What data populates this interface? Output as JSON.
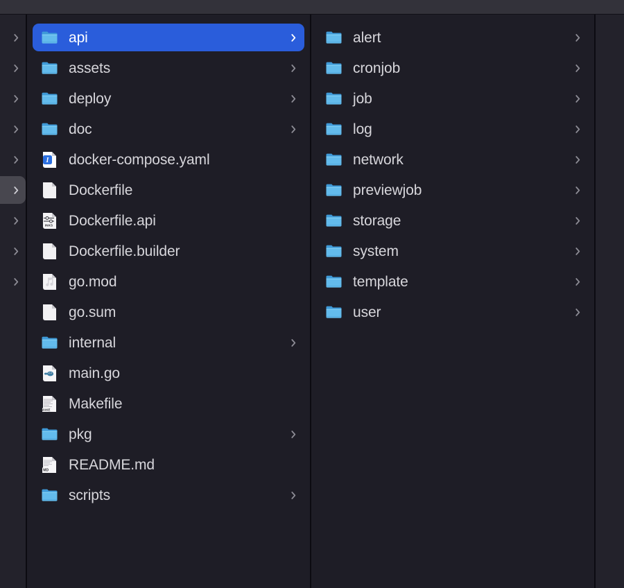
{
  "window": {
    "view_mode": "column-view",
    "titlebar_color": "#33322a"
  },
  "colors": {
    "background": "#1e1d26",
    "selection_active": "#2a5ddb",
    "selection_inactive": "#48474f",
    "divider": "#0c0b11",
    "text": "#d7d6db",
    "text_selected": "#ffffff",
    "chevron": "#8d8c95",
    "folder_blue": "#5bb3e8",
    "folder_tab": "#3f9ad8"
  },
  "columns": [
    {
      "name": "ancestor-column-partial",
      "partial": true,
      "items": [
        {
          "label": "",
          "icon": "folder-icon",
          "kind": "folder",
          "chevron": true,
          "selected": false
        },
        {
          "label": "",
          "icon": "folder-icon",
          "kind": "folder",
          "chevron": true,
          "selected": false
        },
        {
          "label": "",
          "icon": "folder-icon",
          "kind": "folder",
          "chevron": true,
          "selected": false
        },
        {
          "label": "",
          "icon": "folder-icon",
          "kind": "folder",
          "chevron": true,
          "selected": false
        },
        {
          "label": "",
          "icon": "folder-icon",
          "kind": "folder",
          "chevron": true,
          "selected": false
        },
        {
          "label": "",
          "icon": "folder-icon",
          "kind": "folder",
          "chevron": true,
          "selected": "inactive"
        },
        {
          "label": "",
          "icon": "folder-icon",
          "kind": "folder",
          "chevron": true,
          "selected": false
        },
        {
          "label": "",
          "icon": "folder-icon",
          "kind": "folder",
          "chevron": true,
          "selected": false
        },
        {
          "label": "",
          "icon": "folder-icon",
          "kind": "folder",
          "chevron": true,
          "selected": false
        }
      ]
    },
    {
      "name": "project-root-column",
      "partial": false,
      "items": [
        {
          "label": "api",
          "icon": "folder-icon",
          "kind": "folder",
          "chevron": true,
          "selected": true
        },
        {
          "label": "assets",
          "icon": "folder-icon",
          "kind": "folder",
          "chevron": true,
          "selected": false
        },
        {
          "label": "deploy",
          "icon": "folder-icon",
          "kind": "folder",
          "chevron": true,
          "selected": false
        },
        {
          "label": "doc",
          "icon": "folder-icon",
          "kind": "folder",
          "chevron": true,
          "selected": false
        },
        {
          "label": "docker-compose.yaml",
          "icon": "yaml-file-icon",
          "kind": "file",
          "chevron": false,
          "selected": false
        },
        {
          "label": "Dockerfile",
          "icon": "blank-document-icon",
          "kind": "file",
          "chevron": false,
          "selected": false
        },
        {
          "label": "Dockerfile.api",
          "icon": "settings-file-icon",
          "kind": "file",
          "chevron": false,
          "selected": false
        },
        {
          "label": "Dockerfile.builder",
          "icon": "blank-document-icon",
          "kind": "file",
          "chevron": false,
          "selected": false
        },
        {
          "label": "go.mod",
          "icon": "music-file-icon",
          "kind": "file",
          "chevron": false,
          "selected": false
        },
        {
          "label": "go.sum",
          "icon": "blank-document-icon",
          "kind": "file",
          "chevron": false,
          "selected": false
        },
        {
          "label": "internal",
          "icon": "folder-icon",
          "kind": "folder",
          "chevron": true,
          "selected": false
        },
        {
          "label": "main.go",
          "icon": "go-file-icon",
          "kind": "file",
          "chevron": false,
          "selected": false
        },
        {
          "label": "Makefile",
          "icon": "makefile-icon",
          "kind": "file",
          "chevron": false,
          "selected": false
        },
        {
          "label": "pkg",
          "icon": "folder-icon",
          "kind": "folder",
          "chevron": true,
          "selected": false
        },
        {
          "label": "README.md",
          "icon": "markdown-file-icon",
          "kind": "file",
          "chevron": false,
          "selected": false
        },
        {
          "label": "scripts",
          "icon": "folder-icon",
          "kind": "folder",
          "chevron": true,
          "selected": false
        }
      ]
    },
    {
      "name": "api-contents-column",
      "partial": false,
      "items": [
        {
          "label": "alert",
          "icon": "folder-icon",
          "kind": "folder",
          "chevron": true,
          "selected": false
        },
        {
          "label": "cronjob",
          "icon": "folder-icon",
          "kind": "folder",
          "chevron": true,
          "selected": false
        },
        {
          "label": "job",
          "icon": "folder-icon",
          "kind": "folder",
          "chevron": true,
          "selected": false
        },
        {
          "label": "log",
          "icon": "folder-icon",
          "kind": "folder",
          "chevron": true,
          "selected": false
        },
        {
          "label": "network",
          "icon": "folder-icon",
          "kind": "folder",
          "chevron": true,
          "selected": false
        },
        {
          "label": "previewjob",
          "icon": "folder-icon",
          "kind": "folder",
          "chevron": true,
          "selected": false
        },
        {
          "label": "storage",
          "icon": "folder-icon",
          "kind": "folder",
          "chevron": true,
          "selected": false
        },
        {
          "label": "system",
          "icon": "folder-icon",
          "kind": "folder",
          "chevron": true,
          "selected": false
        },
        {
          "label": "template",
          "icon": "folder-icon",
          "kind": "folder",
          "chevron": true,
          "selected": false
        },
        {
          "label": "user",
          "icon": "folder-icon",
          "kind": "folder",
          "chevron": true,
          "selected": false
        }
      ]
    },
    {
      "name": "preview-column-partial",
      "partial": true,
      "items": []
    }
  ],
  "icon_badges": {
    "settings-file-icon": "INKS",
    "go-file-icon": "GO",
    "makefile-icon": "MAKE",
    "markdown-file-icon": "MD"
  }
}
